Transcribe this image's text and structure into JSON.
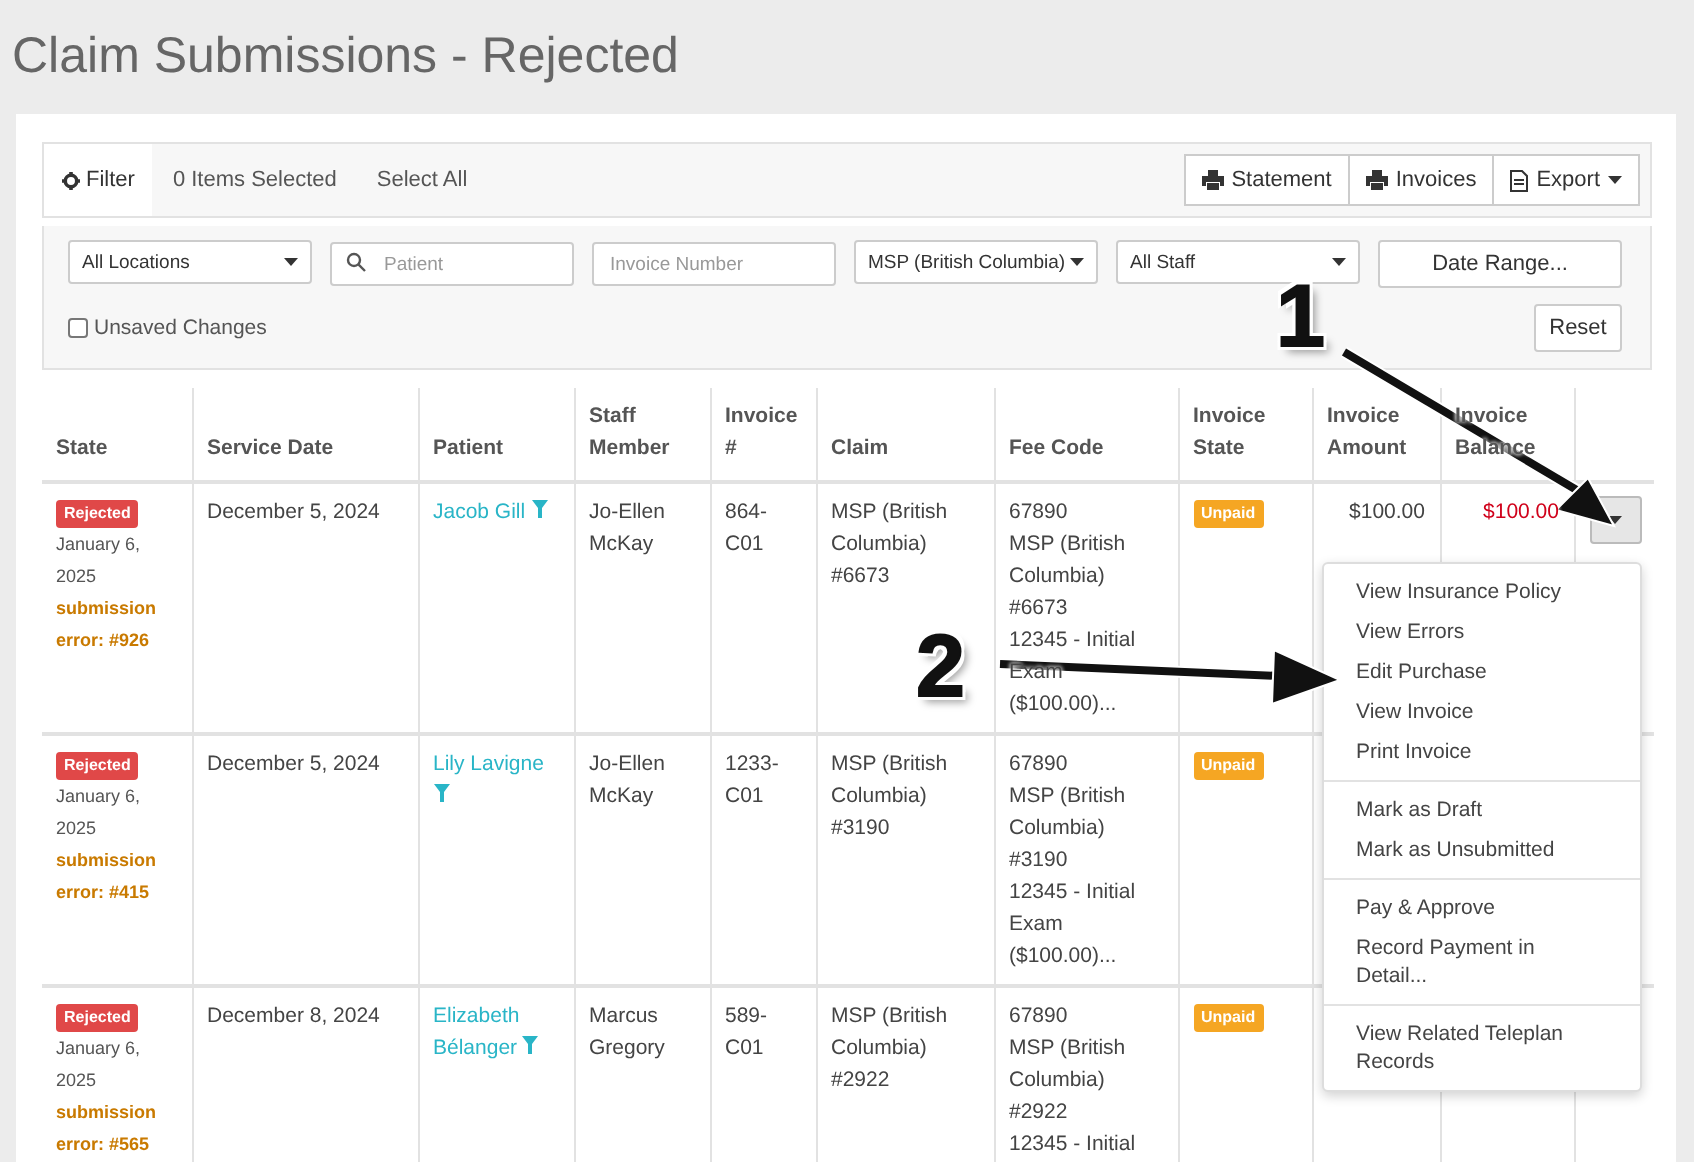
{
  "page_title": "Claim Submissions - Rejected",
  "toolbar": {
    "filter_label": "Filter",
    "selected_count": "0 Items Selected",
    "select_all": "Select All",
    "buttons": [
      {
        "label": "Statement"
      },
      {
        "label": "Invoices"
      },
      {
        "label": "Export"
      }
    ]
  },
  "filters": {
    "location": "All Locations",
    "patient_placeholder": "Patient",
    "invoice_placeholder": "Invoice Number",
    "insurer": "MSP (British Columbia)",
    "staff": "All Staff",
    "date_range": "Date Range...",
    "unsaved_changes": {
      "label": "Unsaved Changes",
      "checked": false
    },
    "reset": "Reset"
  },
  "table": {
    "columns": [
      "State",
      "Service Date",
      "Patient",
      "Staff Member",
      "Invoice #",
      "Claim",
      "Fee Code",
      "Invoice State",
      "Invoice Amount",
      "Invoice Balance"
    ],
    "rows": [
      {
        "state": "Rejected",
        "state_date": "January 6, 2025",
        "error": "submission error: #926",
        "service_date": "December 5, 2024",
        "patient": "Jacob Gill",
        "staff": "Jo-Ellen McKay",
        "invoice": "864-C01",
        "claim": "MSP (British Columbia) #6673",
        "fee_code": [
          "67890",
          "MSP (British Columbia) #6673",
          "12345 - Initial Exam ($100.00)..."
        ],
        "invoice_state": "Unpaid",
        "amount": "$100.00",
        "balance": "$100.00"
      },
      {
        "state": "Rejected",
        "state_date": "January 6, 2025",
        "error": "submission error: #415",
        "service_date": "December 5, 2024",
        "patient": "Lily Lavigne",
        "staff": "Jo-Ellen McKay",
        "invoice": "1233-C01",
        "claim": "MSP (British Columbia) #3190",
        "fee_code": [
          "67890",
          "MSP (British Columbia) #3190",
          "12345 - Initial Exam ($100.00)..."
        ],
        "invoice_state": "Unpaid"
      },
      {
        "state": "Rejected",
        "state_date": "January 6, 2025",
        "error": "submission error: #565",
        "service_date": "December 8, 2024",
        "patient": "Elizabeth Bélanger",
        "staff": "Marcus Gregory",
        "invoice": "589-C01",
        "claim": "MSP (British Columbia) #2922",
        "fee_code": [
          "67890",
          "MSP (British Columbia) #2922",
          "12345 - Initial"
        ],
        "invoice_state": "Unpaid"
      }
    ]
  },
  "row_menu": [
    [
      "View Insurance Policy",
      "View Errors",
      "Edit Purchase",
      "View Invoice",
      "Print Invoice"
    ],
    [
      "Mark as Draft",
      "Mark as Unsubmitted"
    ],
    [
      "Pay & Approve",
      "Record Payment in Detail..."
    ],
    [
      "View Related Teleplan Records"
    ]
  ],
  "annotations": [
    {
      "label": "1"
    },
    {
      "label": "2"
    }
  ]
}
